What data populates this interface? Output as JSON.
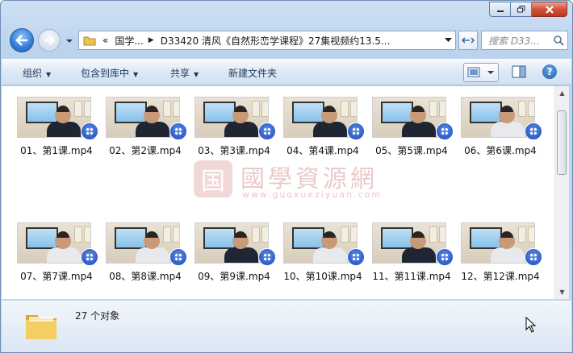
{
  "address": {
    "root_marker": "«",
    "crumb1": "国学...",
    "crumb2": "D33420 清风《自然形峦学课程》27集视频约13.5..."
  },
  "search": {
    "placeholder": "搜索 D33..."
  },
  "toolbar": {
    "organize": "组织",
    "include_library": "包含到库中",
    "share": "共享",
    "new_folder": "新建文件夹"
  },
  "files": [
    {
      "name": "01、第1课.mp4",
      "shirt": "dark"
    },
    {
      "name": "02、第2课.mp4",
      "shirt": "dark"
    },
    {
      "name": "03、第3课.mp4",
      "shirt": "dark"
    },
    {
      "name": "04、第4课.mp4",
      "shirt": "dark"
    },
    {
      "name": "05、第5课.mp4",
      "shirt": "dark"
    },
    {
      "name": "06、第6课.mp4",
      "shirt": "white"
    },
    {
      "name": "07、第7课.mp4",
      "shirt": "white"
    },
    {
      "name": "08、第8课.mp4",
      "shirt": "white"
    },
    {
      "name": "09、第9课.mp4",
      "shirt": "dark"
    },
    {
      "name": "10、第10课.mp4",
      "shirt": "white"
    },
    {
      "name": "11、第11课.mp4",
      "shirt": "dark"
    },
    {
      "name": "12、第12课.mp4",
      "shirt": "white"
    }
  ],
  "watermark": {
    "logo_text": "国",
    "cn_text": "國學資源網",
    "url": "www.guoxueziyuan.com"
  },
  "status": {
    "count": "27 个对象"
  },
  "colors": {
    "accent": "#2f7cd6",
    "close": "#c2351c"
  }
}
